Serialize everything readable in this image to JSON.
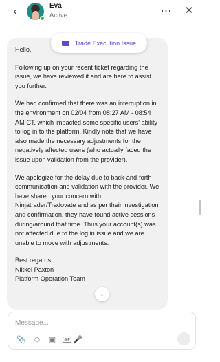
{
  "header": {
    "back_icon": "chevron-left-icon",
    "contact_name": "Eva",
    "contact_status": "Active",
    "status_color": "#3bb54a",
    "more_icon": "more-horizontal-icon",
    "close_icon": "close-icon"
  },
  "topic": {
    "label": "Trade Execution Issue",
    "icon": "ticket-icon",
    "color": "#5b48d6"
  },
  "message": {
    "greeting": "Hello,",
    "paragraphs": [
      "Following up on your recent ticket regarding the issue, we have reviewed it and are here to assist you further.",
      "We had confirmed that there was an interruption in the environment on 02/04 from 08:27 AM - 08:54 AM CT, which impacted some specific users' ability to log in to the platform. Kindly note that we have also made the necessary adjustments for the negatively affected users (who actually faced the issue upon validation from the provider).",
      "We apologize for the delay due to back-and-forth communication and validation with the provider. We have shared your concern with Ninjatrader/Tradovate and as per their investigation and confirmation, they have found active sessions during/around that time. Thus your account(s) was not affected due to the log in issue and we are unable to move with adjustments."
    ],
    "closing": "Best regards,",
    "signature_name": "Nikkei Paxton",
    "signature_team": "Platform Operation Team"
  },
  "composer": {
    "placeholder": "Message...",
    "value": "",
    "tools": [
      "paperclip-icon",
      "emoji-icon",
      "image-icon",
      "gif-icon",
      "microphone-icon"
    ],
    "send_icon": "send-arrow-icon"
  }
}
